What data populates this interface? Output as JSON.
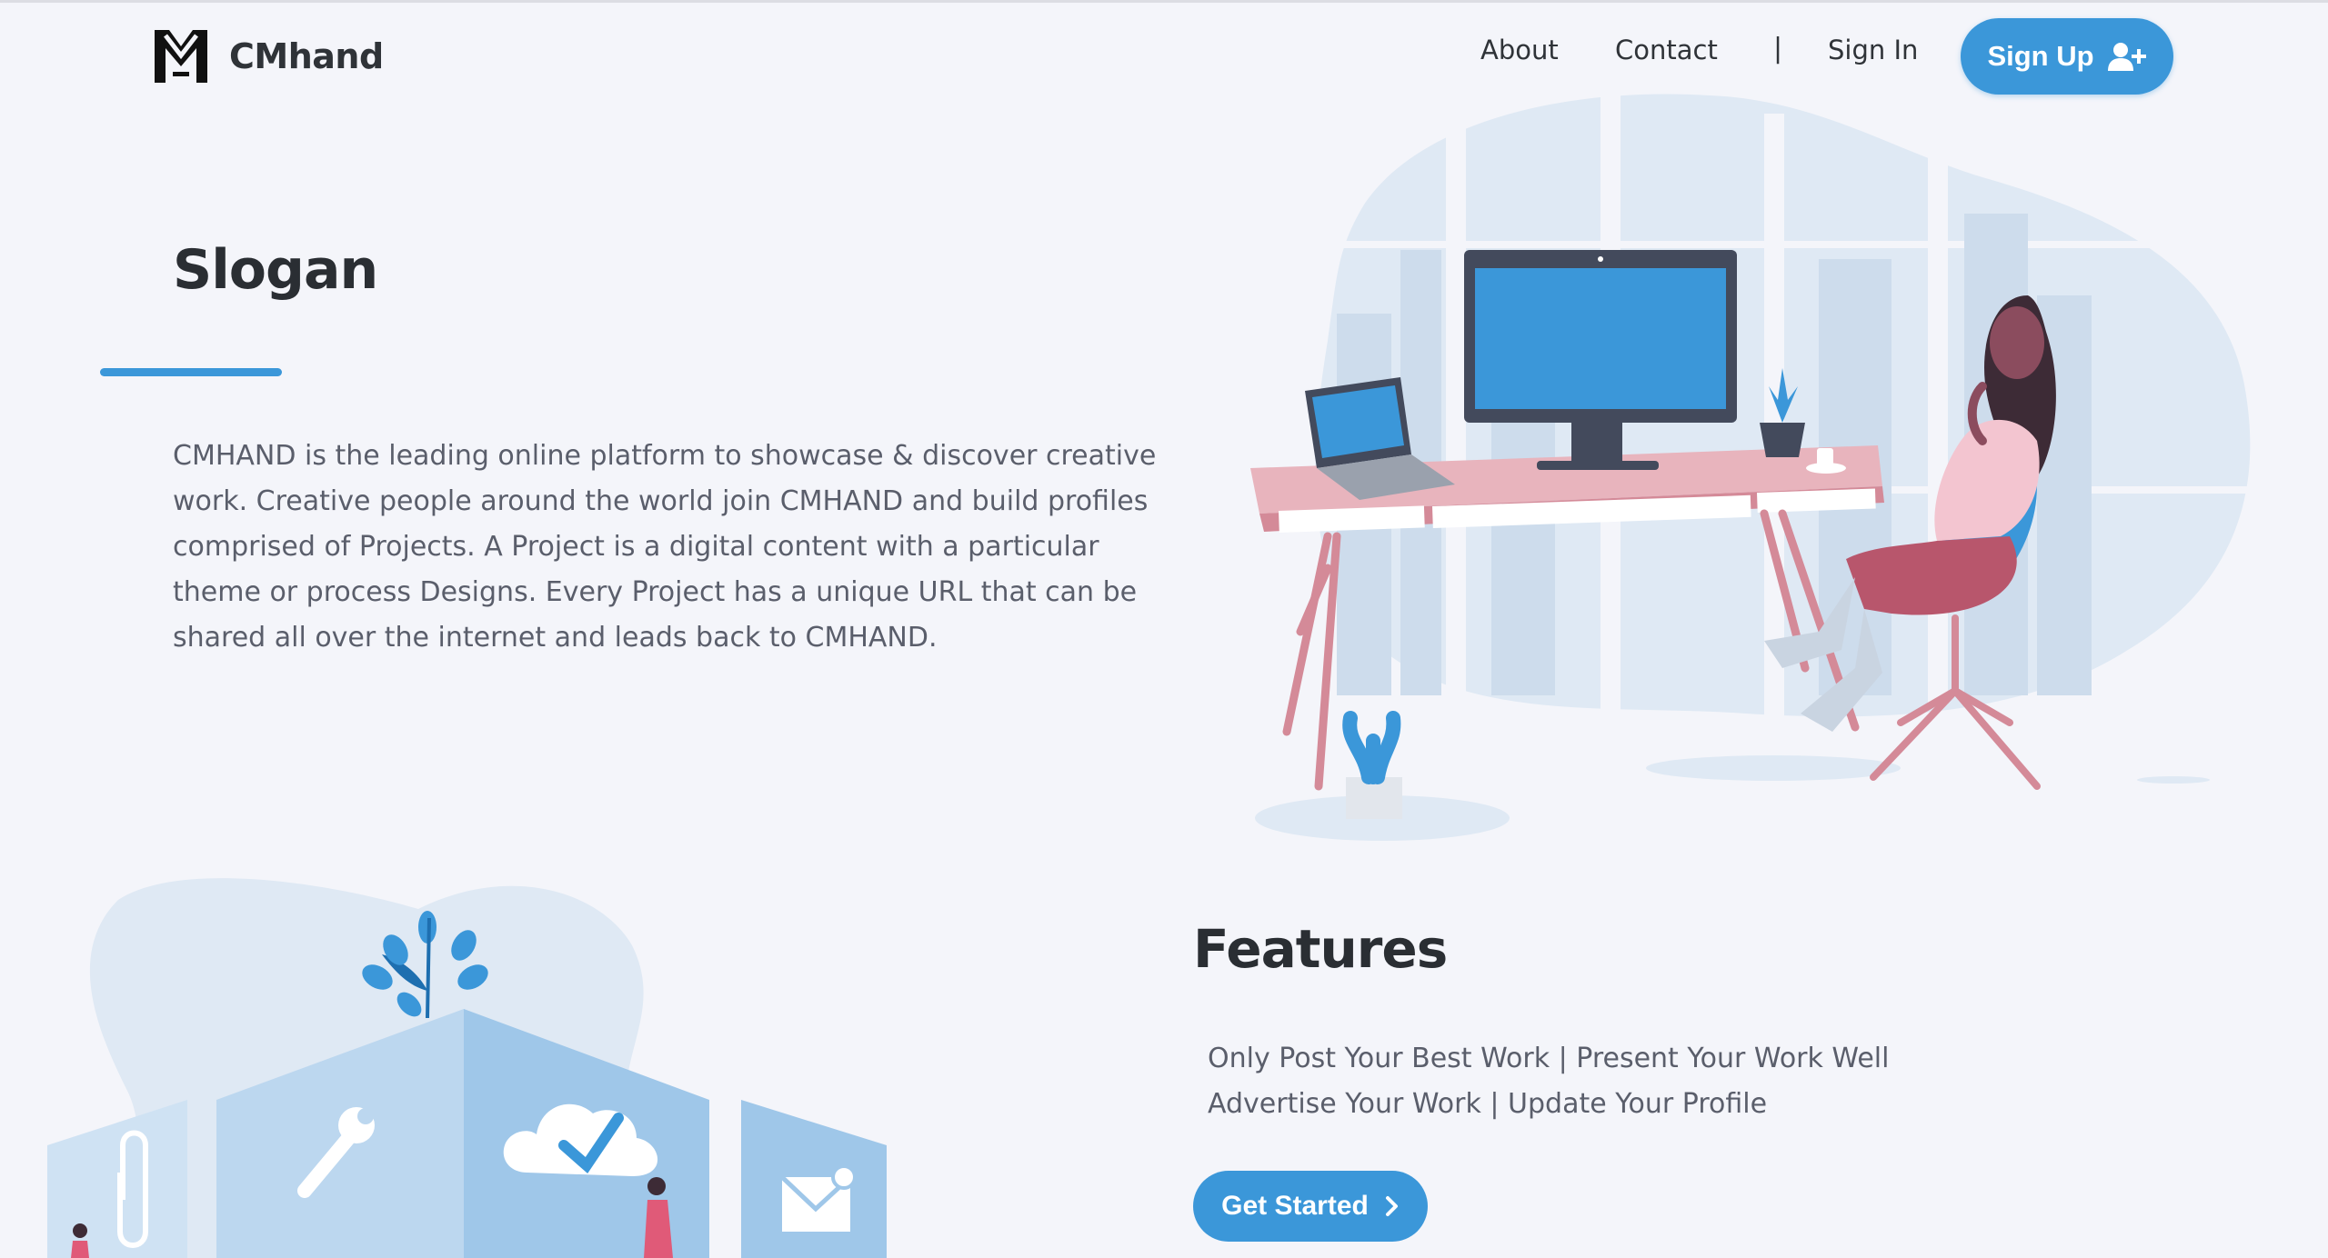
{
  "brand": {
    "name": "CMhand",
    "logo_icon": "cm-monogram-logo"
  },
  "nav": {
    "about": "About",
    "contact": "Contact",
    "separator": "|",
    "sign_in": "Sign In",
    "sign_up": "Sign Up",
    "sign_up_icon": "user-plus-icon"
  },
  "hero": {
    "title": "Slogan",
    "description": "CMHAND is the leading online platform to showcase & discover creative work. Creative people around the world join CMHAND and build profiles comprised of Projects. A Project is a digital content with a particular theme or process Designs. Every Project has a unique URL that can be shared all over the internet and leads back to CMHAND.",
    "illustration": "woman-relaxing-at-desk-illustration"
  },
  "features": {
    "title": "Features",
    "lines": [
      "Only Post Your Best Work | Present Your Work Well",
      "Advertise Your Work | Update Your Profile"
    ],
    "cta": "Get Started",
    "cta_icon": "chevron-right-icon",
    "illustration": "feature-tiles-illustration"
  },
  "colors": {
    "accent": "#3b97d9",
    "background": "#f4f5fa",
    "heading": "#2a2e33",
    "body_text": "#5a5e6b",
    "desk_pink": "#e8b4bd",
    "illustration_light": "#dfe9f4"
  }
}
